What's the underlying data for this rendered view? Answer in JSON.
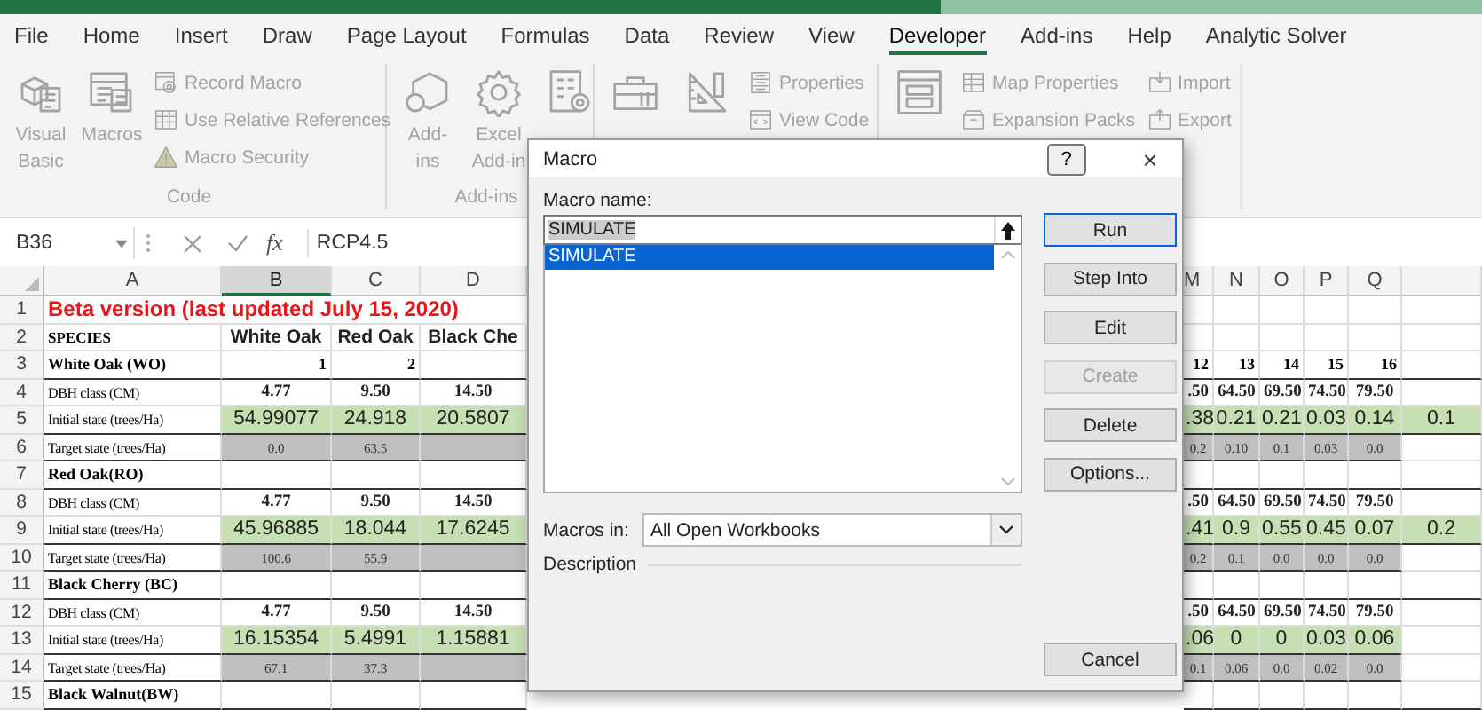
{
  "tabs": [
    {
      "label": "File",
      "selected": false
    },
    {
      "label": "Home",
      "selected": false
    },
    {
      "label": "Insert",
      "selected": false
    },
    {
      "label": "Draw",
      "selected": false
    },
    {
      "label": "Page Layout",
      "selected": false
    },
    {
      "label": "Formulas",
      "selected": false
    },
    {
      "label": "Data",
      "selected": false
    },
    {
      "label": "Review",
      "selected": false
    },
    {
      "label": "View",
      "selected": false
    },
    {
      "label": "Developer",
      "selected": true
    },
    {
      "label": "Add-ins",
      "selected": false
    },
    {
      "label": "Help",
      "selected": false
    },
    {
      "label": "Analytic Solver",
      "selected": false
    }
  ],
  "ribbon": {
    "disabled": true,
    "groups": [
      {
        "label": "Code",
        "items": [
          {
            "kind": "large",
            "lines": [
              "Visual",
              "Basic"
            ]
          },
          {
            "kind": "large",
            "lines": [
              "Macros"
            ]
          },
          {
            "kind": "stack",
            "entries": [
              {
                "label": "Record Macro"
              },
              {
                "label": "Use Relative References"
              },
              {
                "label": "Macro Security"
              }
            ]
          }
        ]
      },
      {
        "label": "Add-ins",
        "items": [
          {
            "kind": "large",
            "lines": [
              "Add-",
              "ins"
            ]
          },
          {
            "kind": "large",
            "lines": [
              "Excel",
              "Add-in"
            ]
          },
          {
            "kind": "large"
          }
        ]
      },
      {
        "items": [
          {
            "kind": "large"
          },
          {
            "kind": "large"
          },
          {
            "kind": "stack",
            "entries": [
              {
                "label": "Properties"
              },
              {
                "label": "View Code"
              }
            ]
          }
        ]
      },
      {
        "items": [
          {
            "kind": "large"
          },
          {
            "kind": "stack",
            "entries": [
              {
                "label": "Map Properties"
              },
              {
                "label": "Expansion Packs"
              }
            ]
          },
          {
            "kind": "stack",
            "entries": [
              {
                "label": "Import"
              },
              {
                "label": "Export"
              }
            ]
          }
        ]
      }
    ]
  },
  "formula_bar": {
    "name_box": "B36",
    "function_label": "fx",
    "formula": "RCP4.5"
  },
  "sheet": {
    "columns": [
      {
        "label": "A",
        "selected": false
      },
      {
        "label": "B",
        "selected": true
      },
      {
        "label": "C",
        "selected": false
      },
      {
        "label": "D",
        "selected": false
      },
      {
        "label": "M",
        "selected": false
      },
      {
        "label": "N",
        "selected": false
      },
      {
        "label": "O",
        "selected": false
      },
      {
        "label": "P",
        "selected": false
      },
      {
        "label": "Q",
        "selected": false
      }
    ],
    "rows": [
      {
        "number": "1",
        "kind": "title",
        "cells": [
          "Beta version (last updated July 15, 2020)",
          null,
          null,
          null,
          null,
          null,
          null,
          null,
          null,
          null
        ]
      },
      {
        "number": "2",
        "kind": "header",
        "cells": [
          "SPECIES",
          "White Oak",
          "Red Oak",
          "Black Che",
          null,
          null,
          null,
          null,
          null,
          null
        ]
      },
      {
        "number": "3",
        "kind": "species",
        "cells": [
          "White Oak (WO)",
          "1",
          "2",
          null,
          "12",
          "13",
          "14",
          "15",
          "16",
          null
        ]
      },
      {
        "number": "4",
        "kind": "dbh",
        "cells": [
          "DBH class (CM)",
          "4.77",
          "9.50",
          "14.50",
          ".50",
          "64.50",
          "69.50",
          "74.50",
          "79.50",
          null
        ]
      },
      {
        "number": "5",
        "kind": "initial",
        "cells": [
          "Initial state (trees/Ha)",
          "54.99077",
          "24.918",
          "20.5807",
          ".38",
          "0.21",
          "0.21",
          "0.03",
          "0.14",
          "0.1"
        ]
      },
      {
        "number": "6",
        "kind": "target",
        "cells": [
          "Target state (trees/Ha)",
          "0.0",
          "63.5",
          null,
          "0.2",
          "0.10",
          "0.1",
          "0.03",
          "0.0",
          null
        ]
      },
      {
        "number": "7",
        "kind": "species",
        "cells": [
          "Red Oak(RO)",
          null,
          null,
          null,
          null,
          null,
          null,
          null,
          null,
          null
        ]
      },
      {
        "number": "8",
        "kind": "dbh",
        "cells": [
          "DBH class (CM)",
          "4.77",
          "9.50",
          "14.50",
          ".50",
          "64.50",
          "69.50",
          "74.50",
          "79.50",
          null
        ]
      },
      {
        "number": "9",
        "kind": "initial",
        "cells": [
          "Initial state (trees/Ha)",
          "45.96885",
          "18.044",
          "17.6245",
          ".41",
          "0.9",
          "0.55",
          "0.45",
          "0.07",
          "0.2"
        ]
      },
      {
        "number": "10",
        "kind": "target",
        "cells": [
          "Target state (trees/Ha)",
          "100.6",
          "55.9",
          null,
          "0.2",
          "0.1",
          "0.0",
          "0.0",
          "0.0",
          null
        ]
      },
      {
        "number": "11",
        "kind": "species",
        "cells": [
          "Black Cherry (BC)",
          null,
          null,
          null,
          null,
          null,
          null,
          null,
          null,
          null
        ]
      },
      {
        "number": "12",
        "kind": "dbh",
        "cells": [
          "DBH class (CM)",
          "4.77",
          "9.50",
          "14.50",
          ".50",
          "64.50",
          "69.50",
          "74.50",
          "79.50",
          null
        ]
      },
      {
        "number": "13",
        "kind": "initial",
        "cells": [
          "Initial state (trees/Ha)",
          "16.15354",
          "5.4991",
          "1.15881",
          ".06",
          "0",
          "0",
          "0.03",
          "0.06",
          null
        ]
      },
      {
        "number": "14",
        "kind": "target",
        "cells": [
          "Target state (trees/Ha)",
          "67.1",
          "37.3",
          null,
          "0.1",
          "0.06",
          "0.0",
          "0.02",
          "0.0",
          null
        ]
      },
      {
        "number": "15",
        "kind": "species",
        "cells": [
          "Black Walnut(BW)",
          null,
          null,
          null,
          null,
          null,
          null,
          null,
          null,
          null
        ]
      }
    ]
  },
  "dialog": {
    "title": "Macro",
    "help": "?",
    "close": "×",
    "name_label": "Macro name:",
    "name_value": "SIMULATE",
    "macros": [
      {
        "label": "SIMULATE",
        "selected": true
      }
    ],
    "location_label": "Macros in:",
    "location_value": "All Open Workbooks",
    "description_label": "Description",
    "buttons": [
      {
        "kind": "run",
        "label": "Run",
        "default": true,
        "disabled": false
      },
      {
        "kind": "step-into",
        "label": "Step Into",
        "default": false,
        "disabled": false
      },
      {
        "kind": "edit",
        "label": "Edit",
        "default": false,
        "disabled": false
      },
      {
        "kind": "create",
        "label": "Create",
        "default": false,
        "disabled": true
      },
      {
        "kind": "delete",
        "label": "Delete",
        "default": false,
        "disabled": false
      },
      {
        "kind": "options",
        "label": "Options...",
        "default": false,
        "disabled": false
      },
      {
        "kind": "cancel",
        "label": "Cancel",
        "default": false,
        "disabled": false
      }
    ]
  }
}
